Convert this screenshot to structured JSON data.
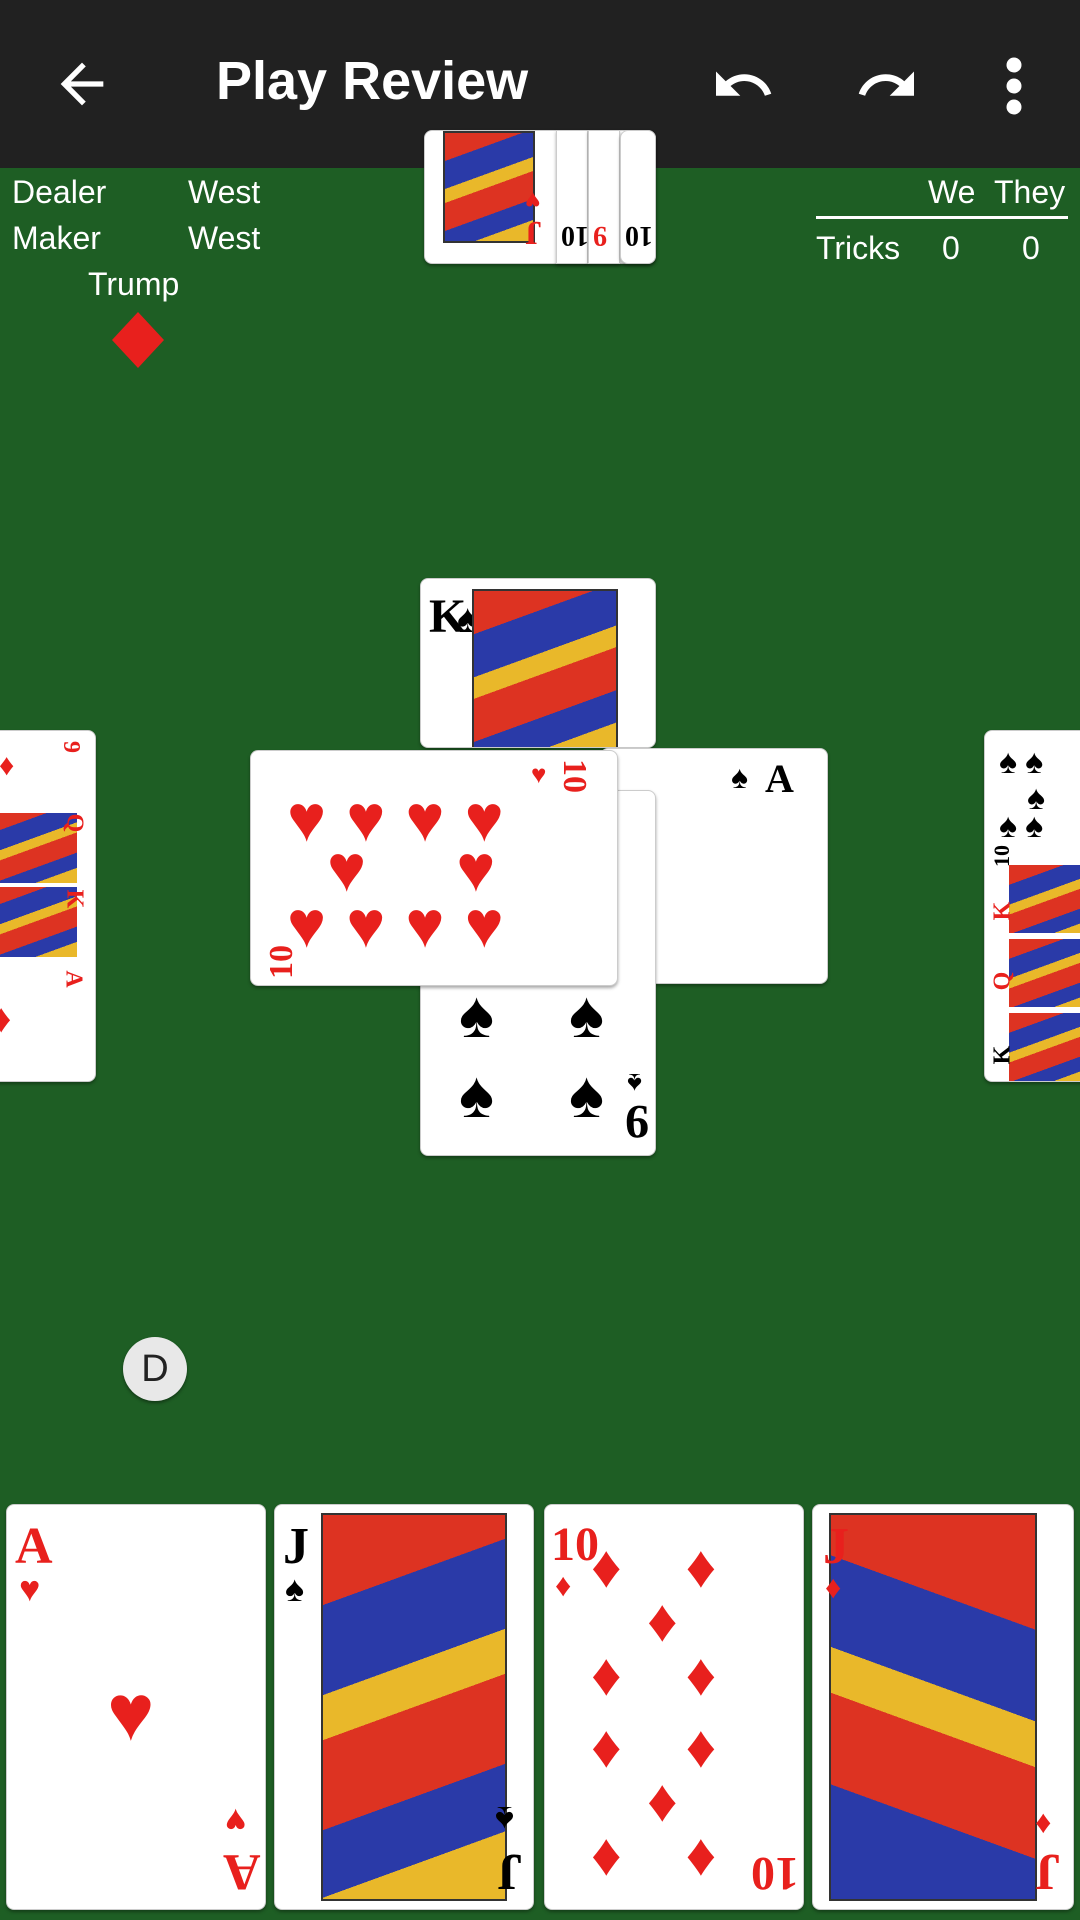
{
  "app_bar": {
    "title": "Play Review",
    "back_icon": "arrow-left-icon",
    "undo_icon": "undo-icon",
    "redo_icon": "redo-icon",
    "more_icon": "more-vert-icon"
  },
  "game_info": {
    "dealer_label": "Dealer",
    "dealer_value": "West",
    "maker_label": "Maker",
    "maker_value": "West",
    "trump_label": "Trump",
    "trump_suit": "diamonds",
    "trump_glyph": "♦"
  },
  "score": {
    "we_label": "We",
    "they_label": "They",
    "tricks_label": "Tricks",
    "we_tricks": "0",
    "they_tricks": "0"
  },
  "north_hand": [
    {
      "rank": "J",
      "suit": "♥"
    },
    {
      "rank": "10",
      "suit": "♠"
    },
    {
      "rank": "9",
      "suit": "♥"
    },
    {
      "rank": "10",
      "suit": "♣"
    }
  ],
  "west_hand": [
    {
      "rank": "9",
      "suit": "♦"
    },
    {
      "rank": "Q",
      "suit": "♦"
    },
    {
      "rank": "K",
      "suit": "♦"
    },
    {
      "rank": "A",
      "suit": "♦"
    }
  ],
  "east_hand": [
    {
      "rank": "10",
      "suit": "♠"
    },
    {
      "rank": "K",
      "suit": "♥"
    },
    {
      "rank": "Q",
      "suit": "♥"
    },
    {
      "rank": "K",
      "suit": "♣"
    }
  ],
  "trick": {
    "north": {
      "rank": "K",
      "suit": "♠"
    },
    "west": {
      "rank": "10",
      "suit": "♥"
    },
    "east": {
      "rank": "A",
      "suit": "♠"
    },
    "south": {
      "rank": "9",
      "suit": "♠"
    }
  },
  "dealer_chip": "D",
  "south_hand": [
    {
      "rank": "A",
      "suit": "♥"
    },
    {
      "rank": "J",
      "suit": "♠"
    },
    {
      "rank": "10",
      "suit": "♦"
    },
    {
      "rank": "J",
      "suit": "♦"
    }
  ],
  "colors": {
    "table": "#1e5e24",
    "app_bar": "#212121",
    "red_suit": "#e8201d"
  }
}
